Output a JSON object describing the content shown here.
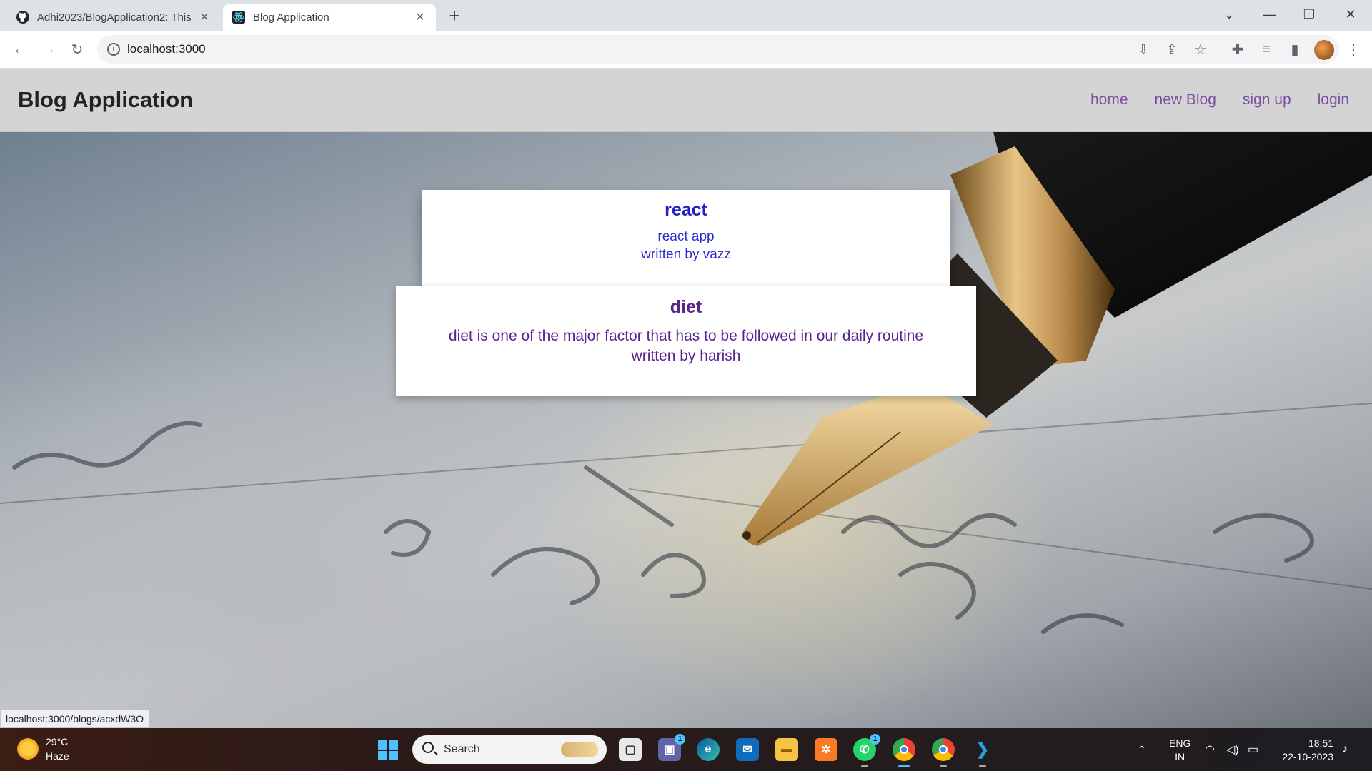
{
  "browser": {
    "tabs": [
      {
        "title": "Adhi2023/BlogApplication2: This",
        "icon": "github-icon",
        "active": false
      },
      {
        "title": "Blog Application",
        "icon": "react-icon",
        "active": true
      }
    ],
    "address": "localhost:3000"
  },
  "app": {
    "brand": "Blog Application",
    "nav": [
      {
        "label": "home"
      },
      {
        "label": "new Blog"
      },
      {
        "label": "sign up"
      },
      {
        "label": "login"
      }
    ]
  },
  "blogs": [
    {
      "title": "react",
      "description": "react app",
      "author_line": "written by vazz",
      "color": "#2020cc"
    },
    {
      "title": "diet",
      "description": "diet is one of the major factor that has to be followed in our daily routine",
      "author_line": "written by harish",
      "color": "#5a2490"
    }
  ],
  "status_url": "localhost:3000/blogs/acxdW3O",
  "taskbar": {
    "weather_temp": "29°C",
    "weather_desc": "Haze",
    "search_label": "Search",
    "teams_badge": "1",
    "whatsapp_badge": "1",
    "lang_line1": "ENG",
    "lang_line2": "IN",
    "time": "18:51",
    "date": "22-10-2023"
  }
}
